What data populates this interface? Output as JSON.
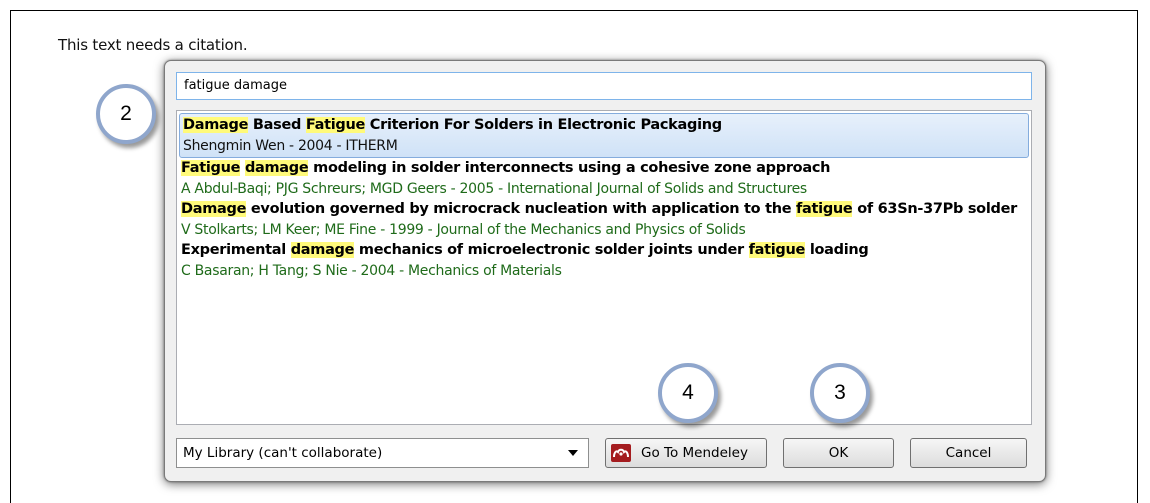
{
  "document": {
    "text": "This text needs a citation."
  },
  "dialog": {
    "search_value": "fatigue damage",
    "results": [
      {
        "title_parts": [
          {
            "t": "Damage",
            "h": true
          },
          {
            "t": " Based ",
            "h": false
          },
          {
            "t": "Fatigue",
            "h": true
          },
          {
            "t": " Criterion For Solders in Electronic Packaging",
            "h": false
          }
        ],
        "meta": "Shengmin Wen - 2004 - ITHERM",
        "selected": true
      },
      {
        "title_parts": [
          {
            "t": "Fatigue",
            "h": true
          },
          {
            "t": " ",
            "h": false
          },
          {
            "t": "damage",
            "h": true
          },
          {
            "t": " modeling in solder interconnects using a cohesive zone approach",
            "h": false
          }
        ],
        "meta": "A Abdul-Baqi; PJG Schreurs; MGD Geers - 2005 - International Journal of Solids and Structures",
        "selected": false
      },
      {
        "title_parts": [
          {
            "t": "Damage",
            "h": true
          },
          {
            "t": " evolution governed by microcrack nucleation with application to the ",
            "h": false
          },
          {
            "t": "fatigue",
            "h": true
          },
          {
            "t": " of 63Sn-37Pb solder",
            "h": false
          }
        ],
        "meta": "V Stolkarts; LM Keer; ME Fine - 1999 - Journal of the Mechanics and Physics of Solids",
        "selected": false
      },
      {
        "title_parts": [
          {
            "t": "Experimental ",
            "h": false
          },
          {
            "t": "damage",
            "h": true
          },
          {
            "t": " mechanics of microelectronic solder joints under ",
            "h": false
          },
          {
            "t": "fatigue",
            "h": true
          },
          {
            "t": " loading",
            "h": false
          }
        ],
        "meta": "C Basaran; H Tang; S Nie - 2004 - Mechanics of Materials",
        "selected": false
      }
    ],
    "library_select": "My Library (can't collaborate)",
    "go_to_mendeley_label": "Go To Mendeley",
    "ok_label": "OK",
    "cancel_label": "Cancel"
  },
  "callouts": {
    "c2": "2",
    "c4": "4",
    "c3": "3"
  },
  "colors": {
    "highlight": "#fffa7a",
    "meta_green": "#1f6b1a",
    "selection": "#cfe2f7",
    "mendeley_logo": "#a41c1f",
    "callout_border": "#8fa6cc"
  },
  "icons": {
    "mendeley": "mendeley-logo-icon",
    "dropdown": "chevron-down-icon"
  }
}
